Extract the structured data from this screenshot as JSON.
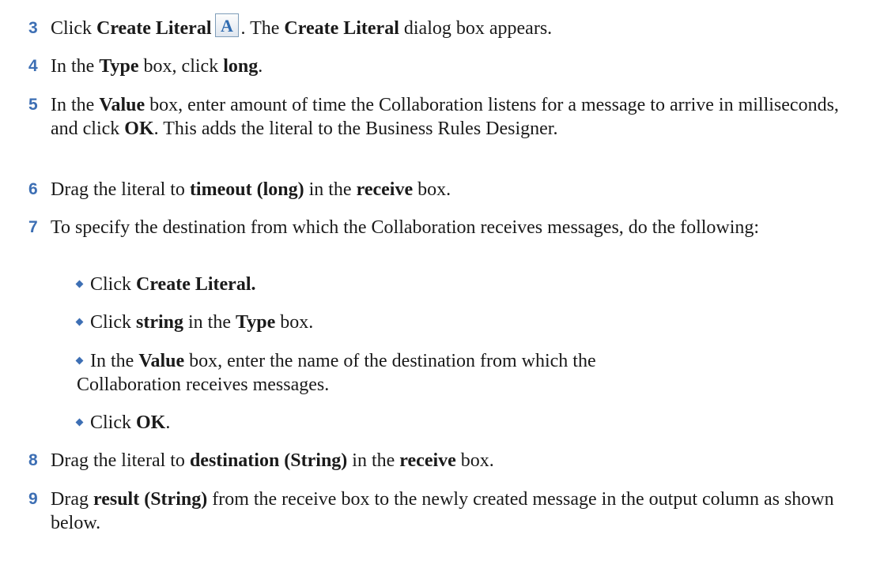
{
  "steps": [
    {
      "number": "3",
      "parts": [
        "Click ",
        "Create Literal",
        ". The ",
        "Create Literal",
        " dialog box appears."
      ],
      "icon": "create-literal-A-icon"
    },
    {
      "number": "4",
      "parts": [
        "In the ",
        "Type",
        " box, click ",
        "long",
        "."
      ]
    },
    {
      "number": "5",
      "parts": [
        "In the ",
        "Value",
        " box, enter amount of time the Collaboration listens for a message to arrive in milliseconds, and click ",
        "OK",
        ". This adds the literal to the Business Rules Designer."
      ]
    },
    {
      "number": "6",
      "parts": [
        "Drag the literal to ",
        "timeout (long)",
        " in the ",
        "receive",
        " box."
      ]
    },
    {
      "number": "7",
      "parts": [
        "To specify the destination from which the Collaboration receives messages, do the following:"
      ],
      "bullets": [
        {
          "parts": [
            "Click ",
            "Create Literal."
          ]
        },
        {
          "parts": [
            "Click ",
            "string",
            " in the ",
            "Type",
            " box."
          ]
        },
        {
          "parts": [
            "In the ",
            "Value",
            " box, enter the name of the destination from which the Collaboration receives messages."
          ]
        },
        {
          "parts": [
            "Click ",
            "OK",
            "."
          ]
        }
      ]
    },
    {
      "number": "8",
      "parts": [
        "Drag the literal to ",
        "destination (String)",
        " in the ",
        "receive",
        " box."
      ]
    },
    {
      "number": "9",
      "parts": [
        "Drag ",
        "result (String)",
        " from the receive box to the newly created message in the output column as shown below."
      ]
    }
  ],
  "colors": {
    "accent": "#3d6fb4",
    "text": "#1a1a1a",
    "background": "#ffffff"
  }
}
